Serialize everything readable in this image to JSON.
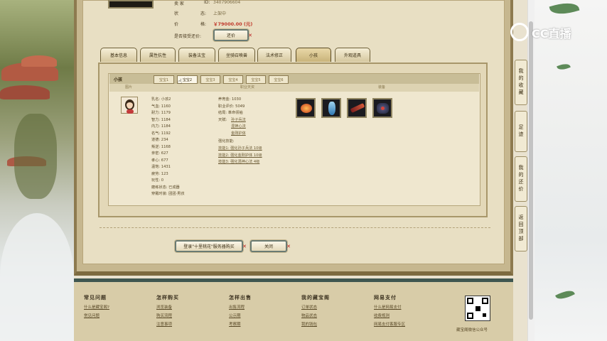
{
  "top_info": {
    "seller_label": "卖 家",
    "seller_id_label": "ID:",
    "seller_id": "3407906604",
    "status_label": "状",
    "status_label2": "态:",
    "status_value": "上架中",
    "price_label": "价",
    "price_label2": "格:",
    "price_value": "￥79000.00 (元)",
    "bargain_label": "是否接受还价:",
    "bargain_button": "还价"
  },
  "tabs": [
    "基本信息",
    "属性抗性",
    "装备法宝",
    "坐骑召唤兽",
    "法术修正",
    "小孩",
    "外观道具"
  ],
  "active_tab": "小孩",
  "panel": {
    "title": "小孩",
    "subtabs": [
      "宝宝1",
      "宝宝2",
      "宝宝3",
      "宝宝4",
      "宝宝5",
      "宝宝6"
    ],
    "active_subtab": "宝宝2",
    "col_headers": {
      "image": "图片",
      "job": "职业天资",
      "equip": "装备"
    },
    "left_stats": [
      "乳名: 小孩2",
      "气血: 1160",
      "耐力: 1179",
      "智力: 1184",
      "内力: 1184",
      "名气: 1192",
      "道德: 234",
      "叛逆: 1168",
      "亲密: 627",
      "孝心: 677",
      "温饱: 1431",
      "疲劳: 123",
      "玩性: 0",
      "磨练状态: 已成器",
      "穿戴时装: 团团·男孩"
    ],
    "mid_stats": {
      "allowance": "养育金: 1030",
      "rating": "职业评价: 5049",
      "profession": "结局: 革命领袖",
      "skill_label": "天赋:",
      "talents": [
        "孙子兵法",
        "混神心法",
        "金刚护体"
      ],
      "enhance_label": "强化技能:",
      "enhance_skills": [
        "技能1: 强化孙子兵法 10级",
        "技能2: 强化金刚护体 10级",
        "技能3: 强化混神心法 4级"
      ]
    },
    "equip_icons": [
      "fire-gourd-icon",
      "blue-vase-icon",
      "sword-scroll-icon",
      "dark-armor-icon"
    ]
  },
  "actions": {
    "login_button": "登录\"十里桃花\"服务器购买",
    "close_button": "关闭"
  },
  "footer": {
    "columns": [
      {
        "title": "常见问题",
        "links": [
          "什么是藏宝阁?",
          "常见问题"
        ]
      },
      {
        "title": "怎样购买",
        "links": [
          "浏览装备",
          "购买流程",
          "注意事项"
        ]
      },
      {
        "title": "怎样出售",
        "links": [
          "出售流程",
          "公示期",
          "考察期"
        ]
      },
      {
        "title": "我的藏宝阁",
        "links": [
          "订单状态",
          "物品状态",
          "我的钱包"
        ]
      },
      {
        "title": "网易支付",
        "links": [
          "什么是网易支付",
          "收费规则",
          "网易支付客服专区"
        ]
      }
    ],
    "qr_caption": "藏宝阁微信公众号"
  },
  "right_nav": [
    "我的收藏",
    "足迹",
    "我的还价",
    "返回顶部"
  ],
  "overlay_logo": "CC直播",
  "colors": {
    "price": "#c0392b",
    "frame": "#c6b78f",
    "dark_teal": "#3f5650"
  }
}
